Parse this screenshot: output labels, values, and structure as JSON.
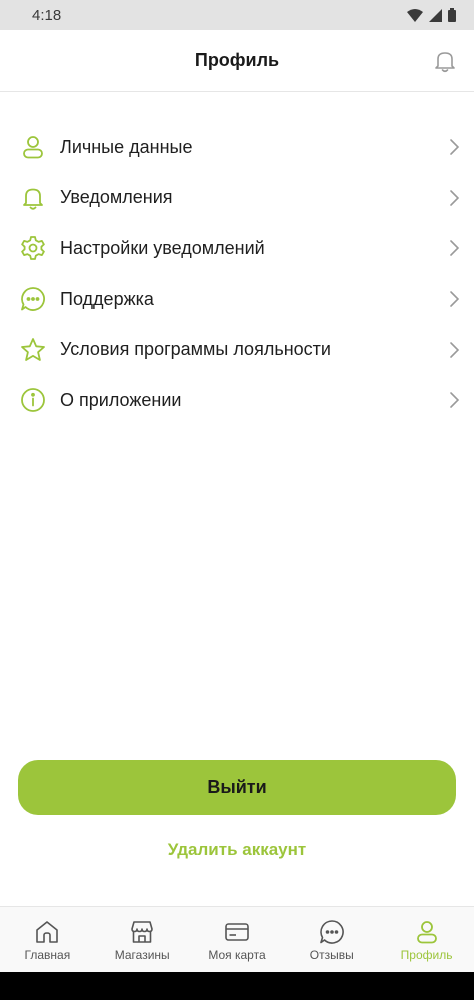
{
  "status_bar": {
    "time": "4:18"
  },
  "header": {
    "title": "Профиль"
  },
  "menu": {
    "items": [
      {
        "label": "Личные данные",
        "icon": "person-icon"
      },
      {
        "label": "Уведомления",
        "icon": "bell-icon"
      },
      {
        "label": "Настройки уведомлений",
        "icon": "gear-icon"
      },
      {
        "label": "Поддержка",
        "icon": "chat-icon"
      },
      {
        "label": "Условия программы лояльности",
        "icon": "star-icon"
      },
      {
        "label": "О приложении",
        "icon": "info-icon"
      }
    ]
  },
  "actions": {
    "logout_label": "Выйти",
    "delete_label": "Удалить аккаунт"
  },
  "bottom_nav": {
    "items": [
      {
        "label": "Главная",
        "icon": "home-icon",
        "active": false
      },
      {
        "label": "Магазины",
        "icon": "store-icon",
        "active": false
      },
      {
        "label": "Моя карта",
        "icon": "card-icon",
        "active": false
      },
      {
        "label": "Отзывы",
        "icon": "chat-icon",
        "active": false
      },
      {
        "label": "Профиль",
        "icon": "person-icon",
        "active": true
      }
    ]
  },
  "colors": {
    "accent": "#9cc53b",
    "text": "#1a1a1a",
    "muted": "#555555"
  }
}
